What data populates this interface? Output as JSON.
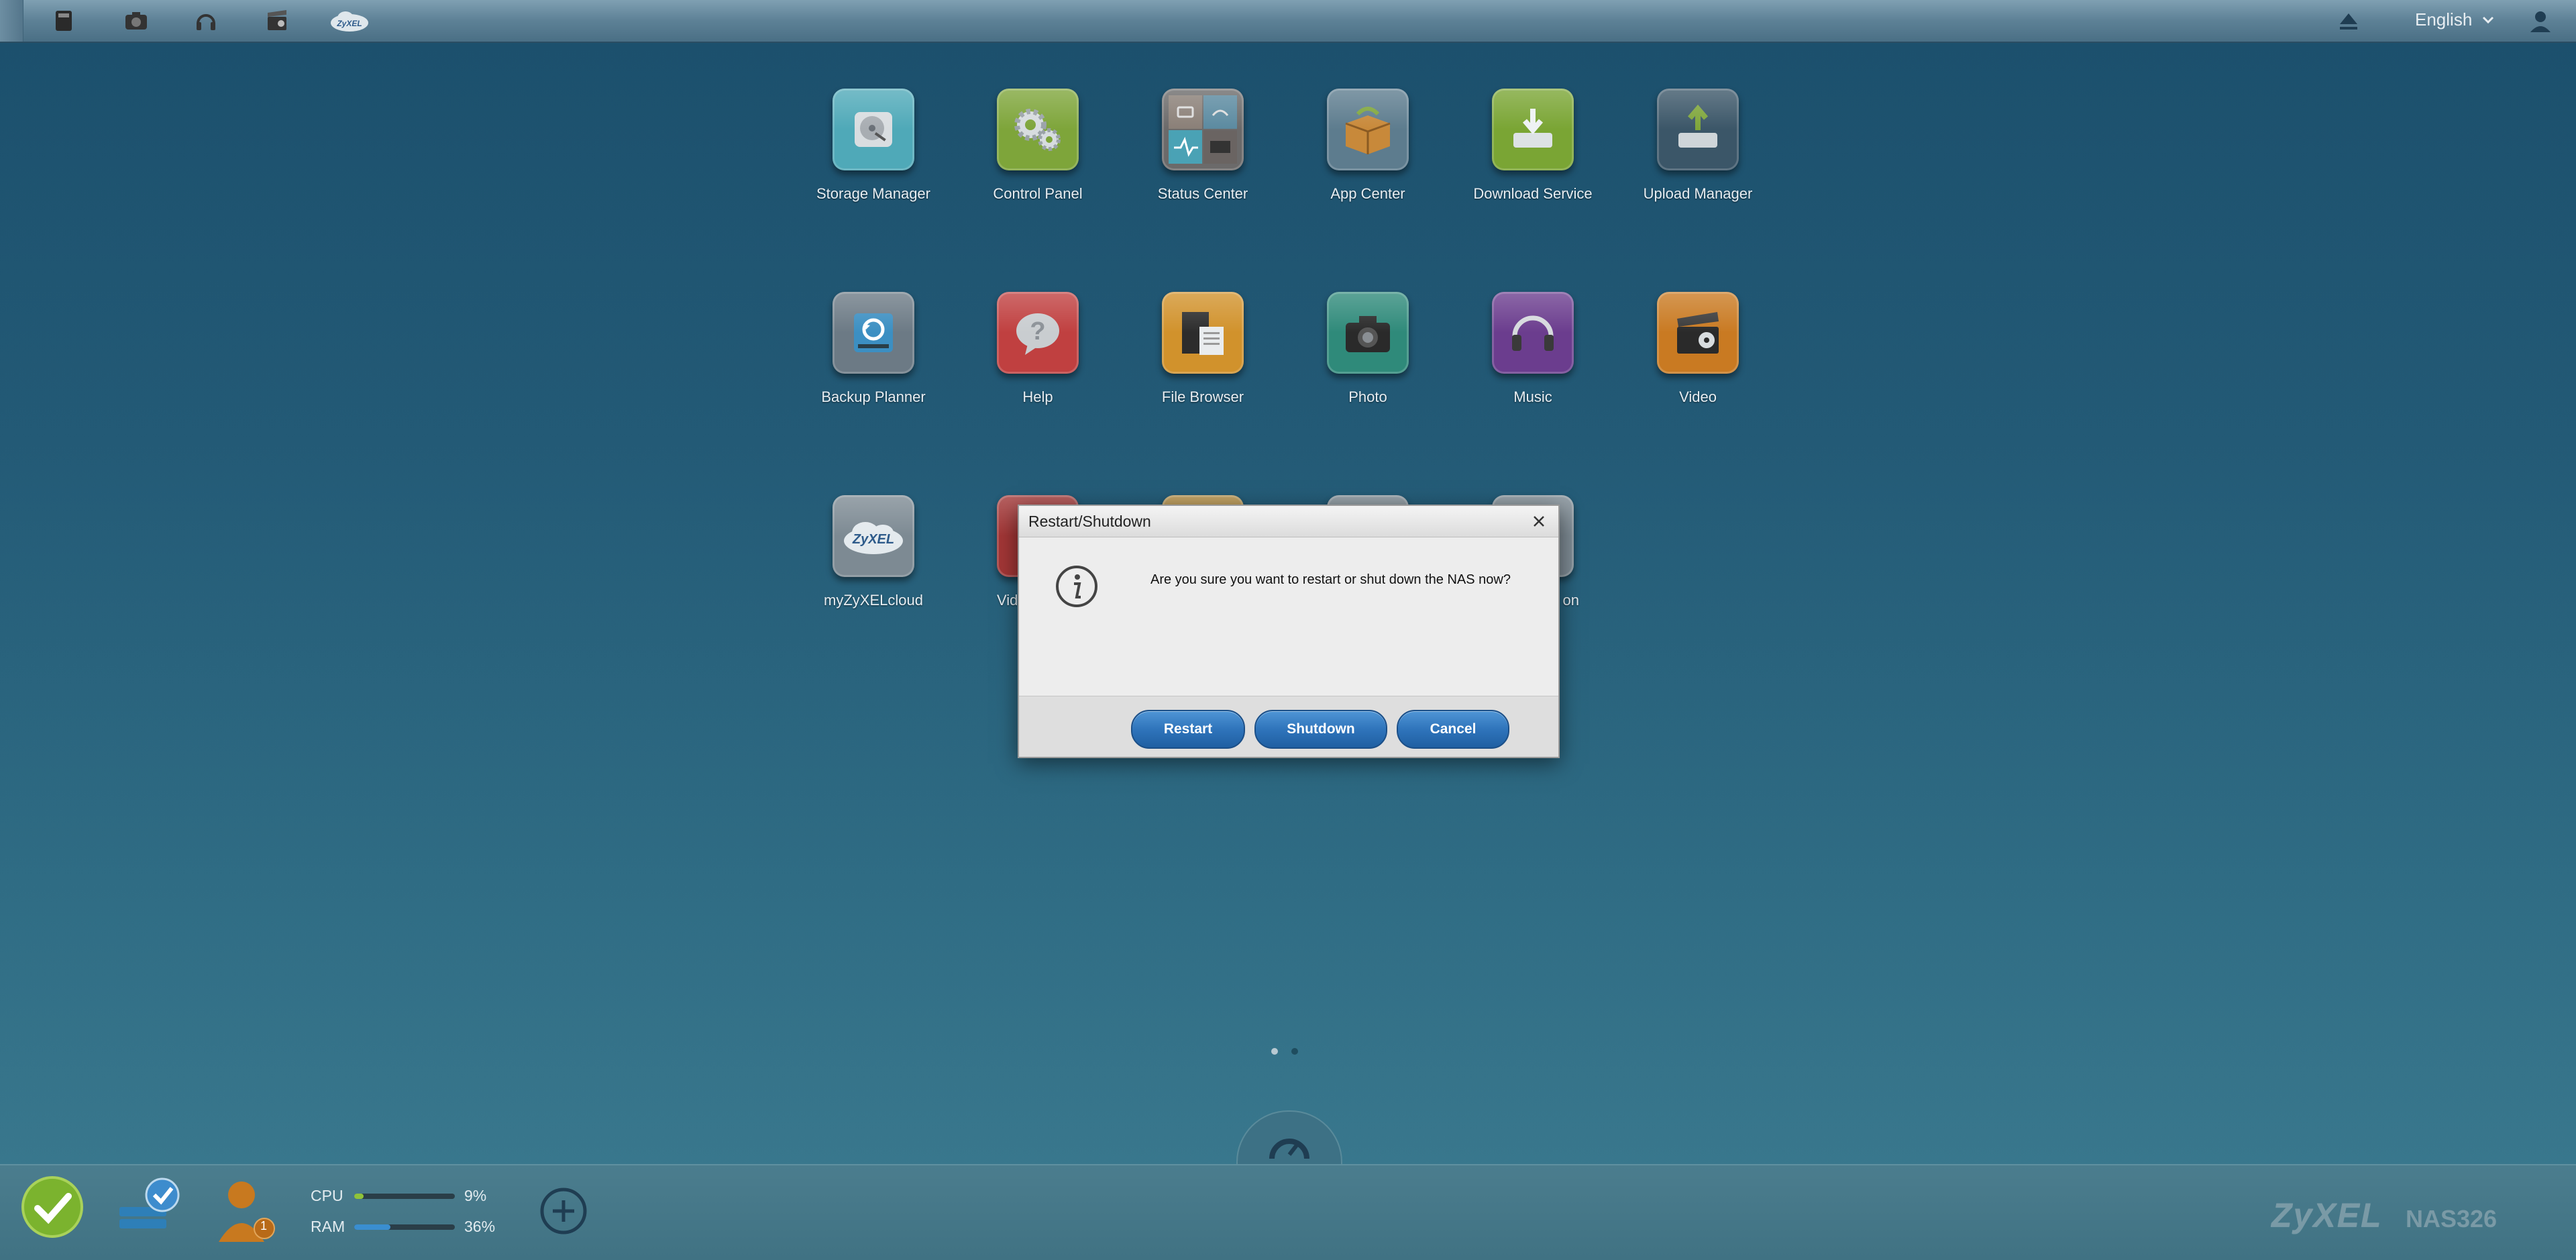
{
  "topbar": {
    "quick_icons": [
      "storage-manager-icon",
      "photo-icon",
      "music-icon",
      "video-icon",
      "zyxel-cloud-icon"
    ],
    "language": "English"
  },
  "apps": [
    {
      "label": "Storage Manager",
      "icon": "hard-disk-icon",
      "color": "#4fa9b8"
    },
    {
      "label": "Control Panel",
      "icon": "gears-icon",
      "color": "#7ea53a"
    },
    {
      "label": "Status Center",
      "icon": "status-tiles-icon",
      "color": "#6b6a6a"
    },
    {
      "label": "App Center",
      "icon": "package-icon",
      "color": "#5d7c8e"
    },
    {
      "label": "Download Service",
      "icon": "download-drive-icon",
      "color": "#7aa534"
    },
    {
      "label": "Upload Manager",
      "icon": "upload-drive-icon",
      "color": "#3b5668"
    },
    {
      "label": "Backup Planner",
      "icon": "backup-icon",
      "color": "#6c7a85"
    },
    {
      "label": "Help",
      "icon": "question-icon",
      "color": "#c04040"
    },
    {
      "label": "File Browser",
      "icon": "folder-icon",
      "color": "#d1922c"
    },
    {
      "label": "Photo",
      "icon": "camera-icon",
      "color": "#2f8a7a"
    },
    {
      "label": "Music",
      "icon": "headphones-icon",
      "color": "#6b3d8e"
    },
    {
      "label": "Video",
      "icon": "clapper-icon",
      "color": "#c97a22"
    },
    {
      "label": "myZyXELcloud",
      "icon": "zyxel-cloud-icon",
      "color": "#7d8a93"
    },
    {
      "label": "Vid",
      "icon": "video-partial-icon",
      "color": "#a23636"
    },
    {
      "label": "on",
      "icon": "app-partial-icon",
      "color": "#7d8a93"
    }
  ],
  "dialog": {
    "title": "Restart/Shutdown",
    "message": "Are you sure you want to restart or shut down the NAS now?",
    "buttons": {
      "restart": "Restart",
      "shutdown": "Shutdown",
      "cancel": "Cancel"
    }
  },
  "bottombar": {
    "cpu_label": "CPU",
    "cpu_value": "9%",
    "cpu_fill": 0.09,
    "ram_label": "RAM",
    "ram_value": "36%",
    "ram_fill": 0.36,
    "user_badge": "1",
    "brand": "ZyXEL",
    "model": "NAS326"
  },
  "colors": {
    "accent": "#2f74bb",
    "status_ok": "#7bb32e"
  }
}
